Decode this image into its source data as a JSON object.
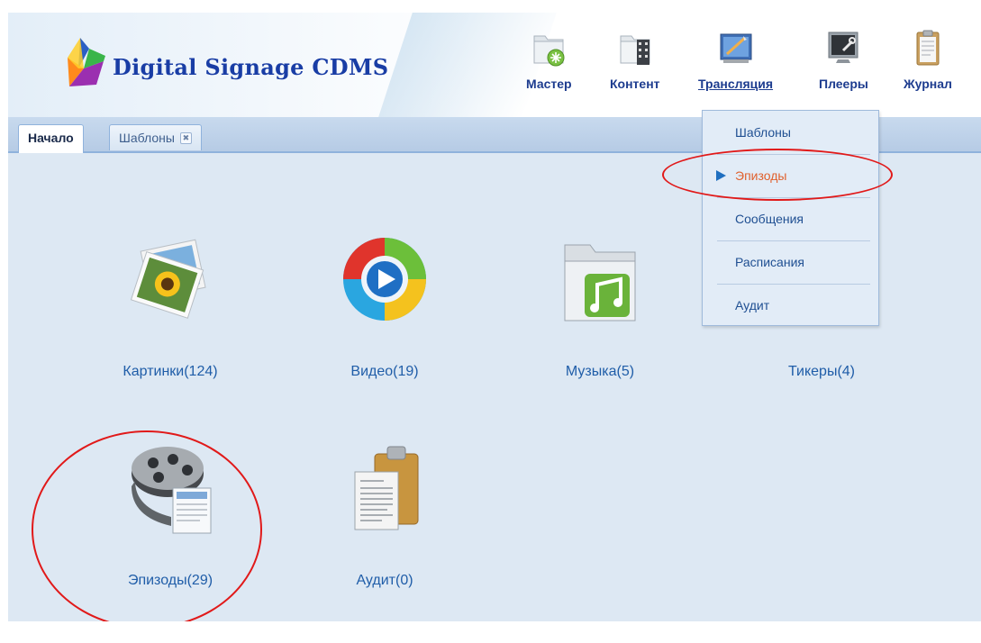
{
  "header": {
    "brand": "Digital Signage CDMS",
    "nav": [
      {
        "label": "Мастер",
        "icon": "folder-add-icon"
      },
      {
        "label": "Контент",
        "icon": "folder-film-icon"
      },
      {
        "label": "Трансляция",
        "icon": "broadcast-board-icon"
      },
      {
        "label": "Плееры",
        "icon": "player-screen-icon"
      },
      {
        "label": "Журнал",
        "icon": "clipboard-icon"
      }
    ]
  },
  "tabs": [
    {
      "label": "Начало",
      "active": true
    },
    {
      "label": "Шаблоны",
      "active": false,
      "close": "✖"
    }
  ],
  "tiles": [
    {
      "label": "Картинки(124)",
      "icon": "pictures-icon"
    },
    {
      "label": "Видео(19)",
      "icon": "video-play-icon"
    },
    {
      "label": "Музыка(5)",
      "icon": "music-folder-icon"
    },
    {
      "label": "Тикеры(4)",
      "icon": "ticker-icon"
    },
    {
      "label": "Эпизоды(29)",
      "icon": "film-reel-document-icon"
    },
    {
      "label": "Аудит(0)",
      "icon": "audit-clipboard-icon"
    }
  ],
  "dropdown": {
    "items": [
      {
        "label": "Шаблоны"
      },
      {
        "label": "Эпизоды",
        "active": true
      },
      {
        "label": "Сообщения"
      },
      {
        "label": "Расписания"
      },
      {
        "label": "Аудит"
      }
    ]
  },
  "colors": {
    "brand": "#193da5",
    "nav_text": "#1d3c8f",
    "tile_text": "#1f5da8",
    "active_menu_text": "#e0602d",
    "annotation": "#e11919",
    "background": "#dde8f3"
  }
}
